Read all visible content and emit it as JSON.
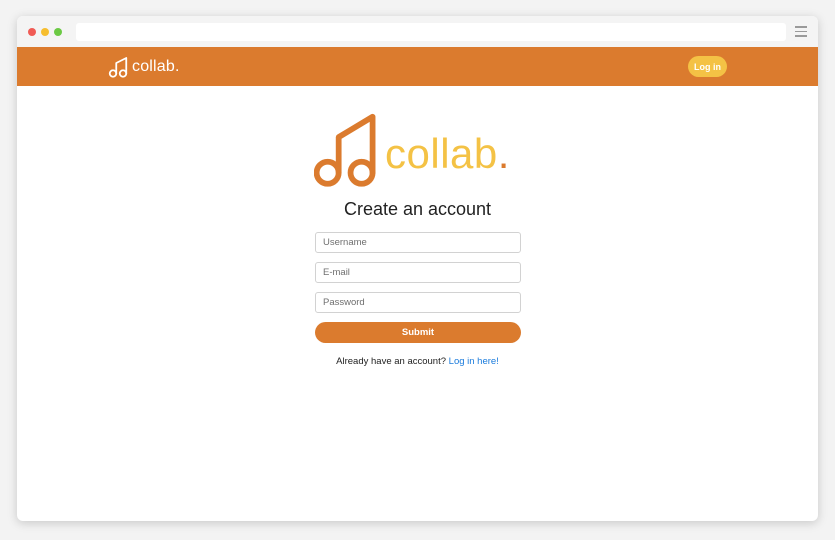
{
  "brand": {
    "name": "collab",
    "period": ".",
    "primary_color": "#db7b2e",
    "accent_color": "#f4c245"
  },
  "navbar": {
    "login_label": "Log in"
  },
  "form": {
    "title": "Create an account",
    "username_placeholder": "Username",
    "email_placeholder": "E-mail",
    "password_placeholder": "Password",
    "submit_label": "Submit",
    "already_text": "Already have an account?",
    "login_link_text": "Log in here!",
    "link_color": "#1a7bdc"
  },
  "browser": {
    "window_controls": [
      "close-dot",
      "minimize-dot",
      "zoom-dot"
    ],
    "menu_icon": "hamburger-icon"
  }
}
